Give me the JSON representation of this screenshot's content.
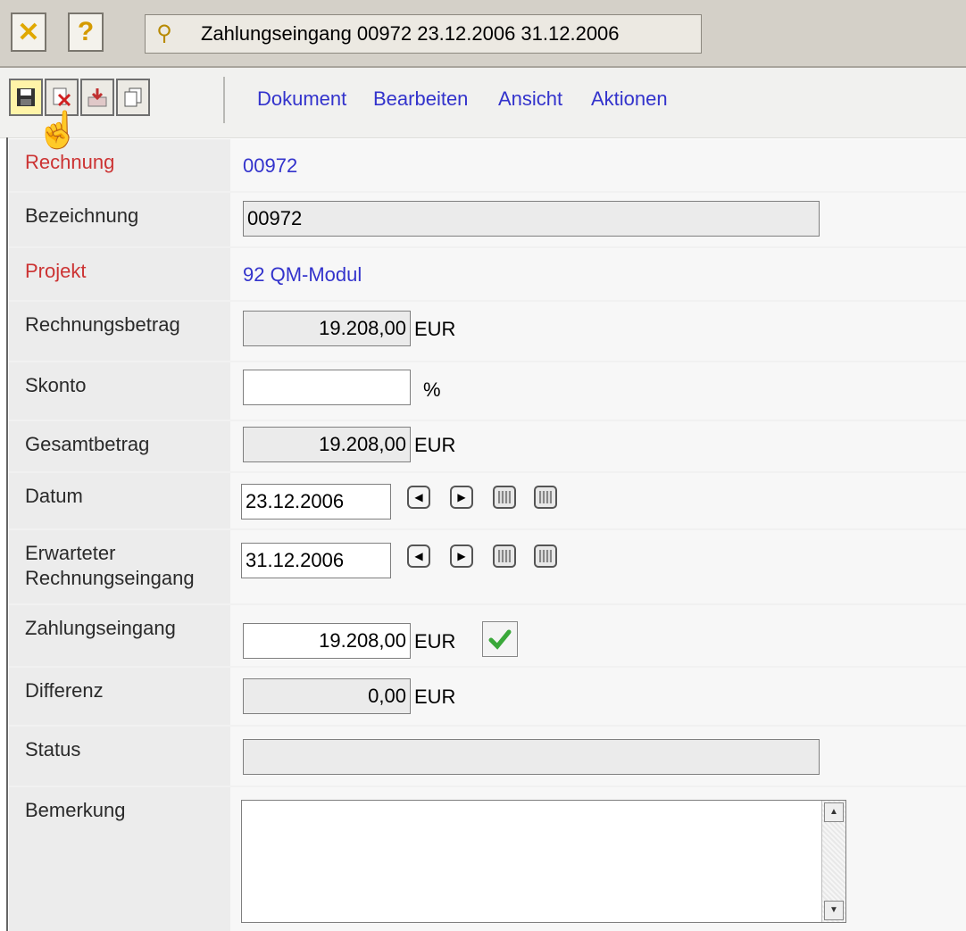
{
  "window": {
    "title": "Zahlungseingang 00972 23.12.2006 31.12.2006",
    "close_icon": "x-close-icon",
    "help_label": "?"
  },
  "toolbar": {
    "icons": [
      "save-icon",
      "delete-icon",
      "download-icon",
      "copy-icon"
    ],
    "menus": [
      "Dokument",
      "Bearbeiten",
      "Ansicht",
      "Aktionen"
    ]
  },
  "form": {
    "rechnung": {
      "label": "Rechnung",
      "value": "00972"
    },
    "bezeichnung": {
      "label": "Bezeichnung",
      "value": "00972"
    },
    "projekt": {
      "label": "Projekt",
      "value": "92 QM-Modul"
    },
    "rechnungsbetrag": {
      "label": "Rechnungsbetrag",
      "value": "19.208,00",
      "unit": "EUR"
    },
    "skonto": {
      "label": "Skonto",
      "value": "",
      "unit": "%"
    },
    "gesamtbetrag": {
      "label": "Gesamtbetrag",
      "value": "19.208,00",
      "unit": "EUR"
    },
    "datum": {
      "label": "Datum",
      "value": "23.12.2006"
    },
    "erwarteter": {
      "label_line1": "Erwarteter",
      "label_line2": "Rechnungseingang",
      "value": "31.12.2006"
    },
    "zahlungseingang": {
      "label": "Zahlungseingang",
      "value": "19.208,00",
      "unit": "EUR"
    },
    "differenz": {
      "label": "Differenz",
      "value": "0,00",
      "unit": "EUR"
    },
    "status": {
      "label": "Status",
      "value": ""
    },
    "bemerkung": {
      "label": "Bemerkung",
      "value": ""
    }
  },
  "colors": {
    "link": "#3333cc",
    "required_label": "#cc3333"
  }
}
